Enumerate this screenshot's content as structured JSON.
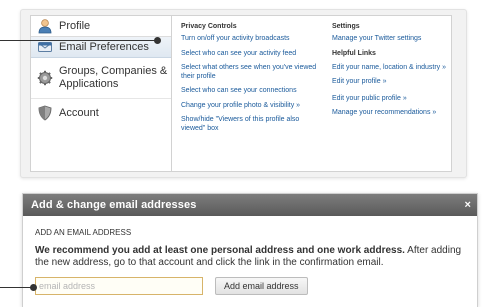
{
  "nav": {
    "items": [
      {
        "label": "Profile",
        "icon": "profile-icon"
      },
      {
        "label": "Email Preferences",
        "icon": "envelope-icon"
      },
      {
        "label": "Groups, Companies & Applications",
        "icon": "gear-icon"
      },
      {
        "label": "Account",
        "icon": "shield-icon"
      }
    ]
  },
  "privacy": {
    "title": "Privacy Controls",
    "links": [
      "Turn on/off your activity broadcasts",
      "Select who can see your activity feed",
      "Select what others see when you've viewed their profile",
      "Select who can see your connections",
      "Change your profile photo & visibility »",
      "Show/hide \"Viewers of this profile also viewed\" box"
    ]
  },
  "settings": {
    "title": "Settings",
    "twitter_link": "Manage your Twitter settings",
    "helpful_title": "Helpful Links",
    "links": [
      "Edit your name, location & industry »",
      "Edit your profile »",
      "Edit your public profile »",
      "Manage your recommendations »"
    ]
  },
  "modal": {
    "title": "Add & change email addresses",
    "close_label": "×",
    "section_label": "ADD AN EMAIL ADDRESS",
    "desc_bold": "We recommend you add at least one personal address and one work address.",
    "desc_rest": " After adding the new address, go to that account and click the link in the confirmation email.",
    "input_placeholder": "email address",
    "button_label": "Add email address"
  },
  "colors": {
    "link": "#1a5a9b",
    "modal_header": "#666666",
    "selected_nav": "#dfe8f1"
  }
}
